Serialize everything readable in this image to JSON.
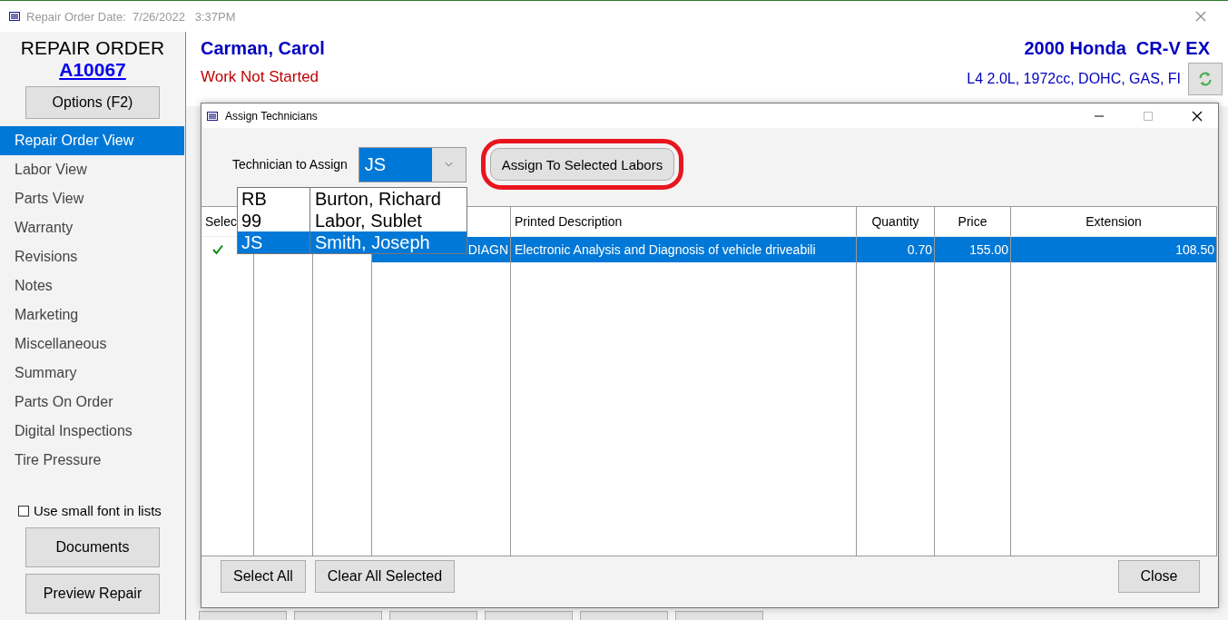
{
  "window": {
    "title": "Repair Order Date:  7/26/2022   3:37PM"
  },
  "sidebar": {
    "heading": "REPAIR ORDER",
    "order_number": "A10067",
    "options_button": "Options (F2)",
    "items": [
      {
        "label": "Repair Order View",
        "selected": true
      },
      {
        "label": "Labor View",
        "selected": false
      },
      {
        "label": "Parts View",
        "selected": false
      },
      {
        "label": "Warranty",
        "selected": false
      },
      {
        "label": "Revisions",
        "selected": false
      },
      {
        "label": "Notes",
        "selected": false
      },
      {
        "label": "Marketing",
        "selected": false
      },
      {
        "label": "Miscellaneous",
        "selected": false
      },
      {
        "label": "Summary",
        "selected": false
      },
      {
        "label": "Parts On Order",
        "selected": false
      },
      {
        "label": "Digital Inspections",
        "selected": false
      },
      {
        "label": "Tire Pressure",
        "selected": false
      }
    ],
    "small_font_option": {
      "label": "Use small font in lists",
      "checked": false
    },
    "buttons": [
      "Documents",
      "Preview Repair"
    ]
  },
  "header": {
    "customer": "Carman, Carol",
    "status": "Work Not Started",
    "vehicle": "2000 Honda  CR-V EX",
    "engine": "L4 2.0L, 1972cc, DOHC, GAS, FI"
  },
  "dialog": {
    "title": "Assign Technicians",
    "technician_label": "Technician to Assign",
    "technician_value": "JS",
    "technician_options": [
      {
        "code": "RB",
        "name": "Burton, Richard",
        "selected": false
      },
      {
        "code": "99",
        "name": "Labor, Sublet",
        "selected": false
      },
      {
        "code": "JS",
        "name": "Smith, Joseph",
        "selected": true
      }
    ],
    "assign_button": {
      "label": "Assign To Selected Labors",
      "highlighted": true
    },
    "columns": [
      {
        "label": "Selec"
      },
      {
        "kind": "blank"
      },
      {
        "kind": "blank"
      },
      {
        "kind": "blank"
      },
      {
        "label": "Printed Description"
      },
      {
        "label": "Quantity"
      },
      {
        "label": "Price"
      },
      {
        "label": "Extension"
      }
    ],
    "rows": [
      {
        "checked": true,
        "selected": true,
        "cells": [
          null,
          null,
          null,
          "DIAGN",
          "Electronic Analysis and Diagnosis of vehicle driveabili",
          "0.70",
          "155.00",
          "108.50"
        ]
      }
    ],
    "footer_buttons": [
      "Select All",
      "Clear All Selected"
    ],
    "close_button": "Close"
  }
}
